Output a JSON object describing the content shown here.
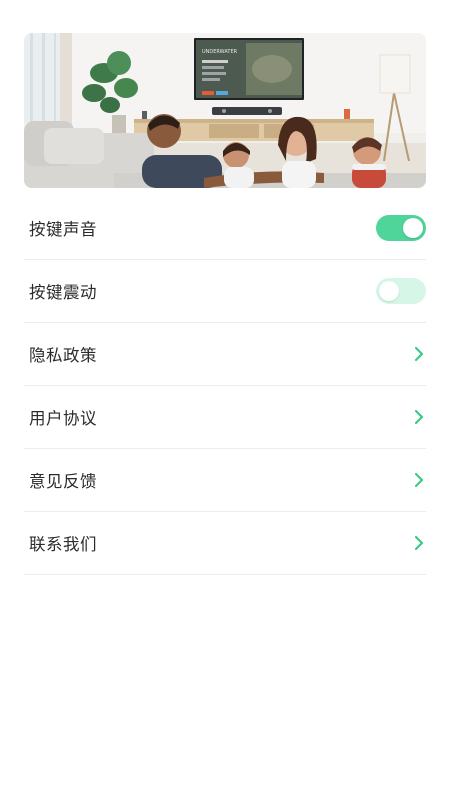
{
  "banner": {
    "description_icon": "family-watching-tv-illustration"
  },
  "settings": {
    "items": [
      {
        "label": "按键声音",
        "control": "toggle",
        "state": "on"
      },
      {
        "label": "按键震动",
        "control": "toggle",
        "state": "off"
      },
      {
        "label": "隐私政策",
        "control": "chevron"
      },
      {
        "label": "用户协议",
        "control": "chevron"
      },
      {
        "label": "意见反馈",
        "control": "chevron"
      },
      {
        "label": "联系我们",
        "control": "chevron"
      }
    ]
  },
  "colors": {
    "accent": "#4fd49a",
    "toggle_off": "#d6f7e8",
    "chevron": "#3cc98a",
    "divider": "#ececec",
    "text": "#2b2b2b"
  },
  "tv_screen": {
    "title": "UNDERWATER"
  }
}
